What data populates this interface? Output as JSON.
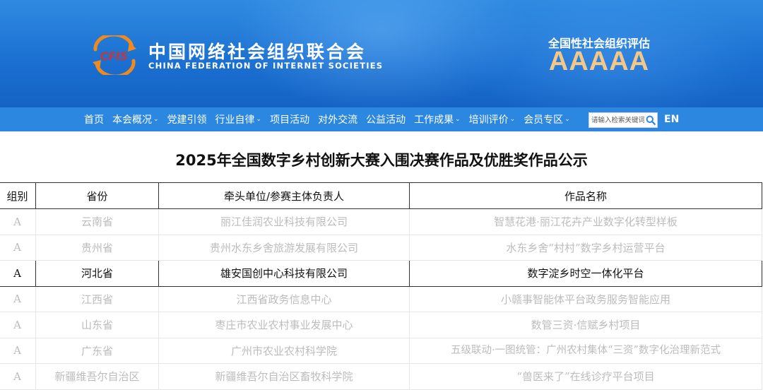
{
  "header": {
    "logo_text": "CFIS",
    "org_name_cn": "中国网络社会组织联合会",
    "org_name_en": "CHINA FEDERATION OF INTERNET SOCIETIES",
    "eval_label": "全国性社会组织评估",
    "eval_grade": "AAAAA"
  },
  "nav": {
    "items": [
      {
        "label": "首页",
        "dropdown": false
      },
      {
        "label": "本会概况",
        "dropdown": true
      },
      {
        "label": "党建引领",
        "dropdown": false
      },
      {
        "label": "行业自律",
        "dropdown": true
      },
      {
        "label": "项目活动",
        "dropdown": false
      },
      {
        "label": "对外交流",
        "dropdown": false
      },
      {
        "label": "公益活动",
        "dropdown": false
      },
      {
        "label": "工作成果",
        "dropdown": true
      },
      {
        "label": "培训评价",
        "dropdown": true
      },
      {
        "label": "会员专区",
        "dropdown": true
      }
    ],
    "search_placeholder": "请输入检索关键词",
    "lang": "EN"
  },
  "page": {
    "title": "2025年全国数字乡村创新大赛入围决赛作品及优胜奖作品公示"
  },
  "table": {
    "headers": [
      "组别",
      "省份",
      "牵头单位/参赛主体负责人",
      "作品名称"
    ],
    "rows": [
      {
        "group": "A",
        "province": "云南省",
        "unit": "丽江佳润农业科技有限公司",
        "work": "智慧花港·丽江花卉产业数字化转型样板",
        "highlight": false
      },
      {
        "group": "A",
        "province": "贵州省",
        "unit": "贵州水东乡舍旅游发展有限公司",
        "work": "水东乡舍“村村”数字乡村运营平台",
        "highlight": false
      },
      {
        "group": "A",
        "province": "河北省",
        "unit": "雄安国创中心科技有限公司",
        "work": "数字淀乡时空一体化平台",
        "highlight": true
      },
      {
        "group": "A",
        "province": "江西省",
        "unit": "江西省政务信息中心",
        "work": "小赣事智能体平台政务服务智能应用",
        "highlight": false
      },
      {
        "group": "A",
        "province": "山东省",
        "unit": "枣庄市农业农村事业发展中心",
        "work": "数管三资·信赋乡村项目",
        "highlight": false
      },
      {
        "group": "A",
        "province": "广东省",
        "unit": "广州市农业农村科学院",
        "work": "五级联动·一图统管：广州农村集体“三资”数字化治理新范式",
        "highlight": false
      },
      {
        "group": "A",
        "province": "新疆维吾尔自治区",
        "unit": "新疆维吾尔自治区畜牧科学院",
        "work": "“兽医来了”在线诊疗平台项目",
        "highlight": false
      }
    ]
  },
  "colors": {
    "header_blue": "#1a6fd0",
    "nav_blue": "#2b87e0",
    "grade_gold": "#f3c787",
    "logo_orange": "#f08a1c",
    "logo_red": "#d9302a"
  }
}
